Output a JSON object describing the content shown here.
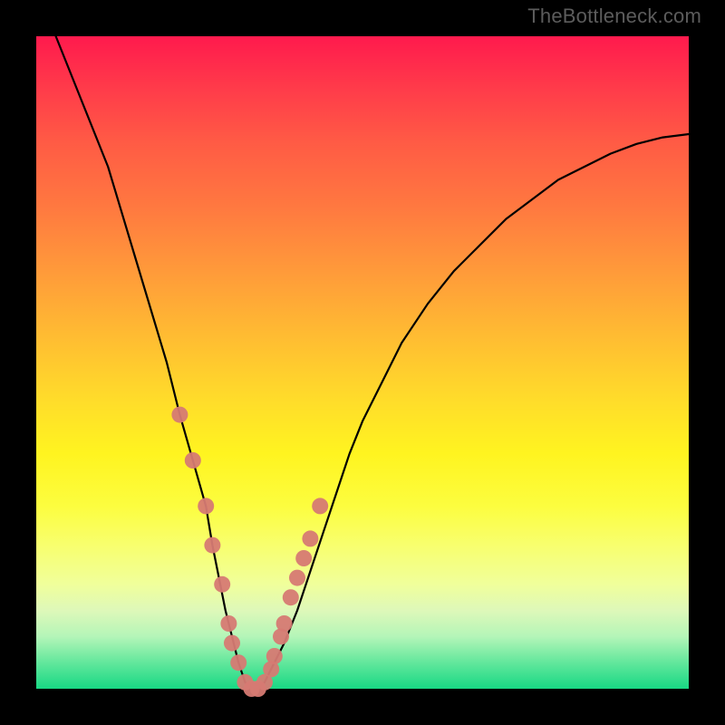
{
  "watermark": "TheBottleneck.com",
  "chart_data": {
    "type": "line",
    "title": "",
    "xlabel": "",
    "ylabel": "",
    "xlim": [
      0,
      100
    ],
    "ylim": [
      0,
      100
    ],
    "curve": {
      "x": [
        3,
        7,
        11,
        14,
        17,
        20,
        22,
        24,
        26,
        27,
        28,
        29,
        30,
        31,
        32,
        33,
        34,
        35,
        36,
        38,
        40,
        42,
        44,
        46,
        48,
        50,
        53,
        56,
        60,
        64,
        68,
        72,
        76,
        80,
        84,
        88,
        92,
        96,
        100
      ],
      "y": [
        100,
        90,
        80,
        70,
        60,
        50,
        42,
        35,
        28,
        22,
        17,
        12,
        8,
        4,
        1,
        0,
        0,
        1,
        3,
        7,
        12,
        18,
        24,
        30,
        36,
        41,
        47,
        53,
        59,
        64,
        68,
        72,
        75,
        78,
        80,
        82,
        83.5,
        84.5,
        85
      ]
    },
    "marker_series": {
      "name": "highlight",
      "color": "#d67a73",
      "x": [
        22,
        24,
        26,
        27,
        28.5,
        29.5,
        30,
        31,
        32,
        33,
        34,
        35,
        36,
        36.5,
        37.5,
        38,
        39,
        40,
        41,
        42,
        43.5
      ],
      "y": [
        42,
        35,
        28,
        22,
        16,
        10,
        7,
        4,
        1,
        0,
        0,
        1,
        3,
        5,
        8,
        10,
        14,
        17,
        20,
        23,
        28
      ]
    }
  }
}
